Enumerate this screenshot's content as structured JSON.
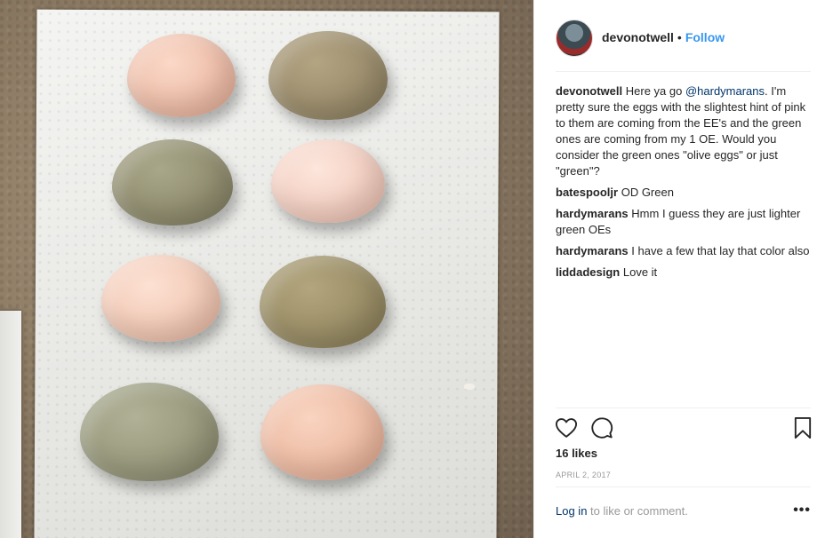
{
  "post": {
    "username": "devonotwell",
    "separator": "•",
    "follow_label": "Follow"
  },
  "comments": [
    {
      "user": "devonotwell",
      "prefix": "Here ya go ",
      "mention": "@hardymarans",
      "text": ". I'm pretty sure the eggs with the slightest hint of pink to them are coming from the EE's and the green ones are coming from my 1 OE. Would you consider the green ones \"olive eggs\" or just \"green\"?"
    },
    {
      "user": "batespooljr",
      "text": "OD Green"
    },
    {
      "user": "hardymarans",
      "text": "Hmm I guess they are just lighter green OEs"
    },
    {
      "user": "hardymarans",
      "text": "I have a few that lay that color also"
    },
    {
      "user": "liddadesign",
      "text": "Love it"
    }
  ],
  "engagement": {
    "likes": "16 likes",
    "date": "APRIL 2, 2017"
  },
  "footer": {
    "login_label": "Log in",
    "login_suffix": " to like or comment.",
    "more_label": "•••"
  },
  "icons": {
    "like": "heart-icon",
    "comment": "comment-bubble-icon",
    "save": "bookmark-icon",
    "more": "more-options-icon"
  },
  "colors": {
    "link_blue": "#3897f0",
    "text_dark": "#262626",
    "muted": "#999999"
  }
}
